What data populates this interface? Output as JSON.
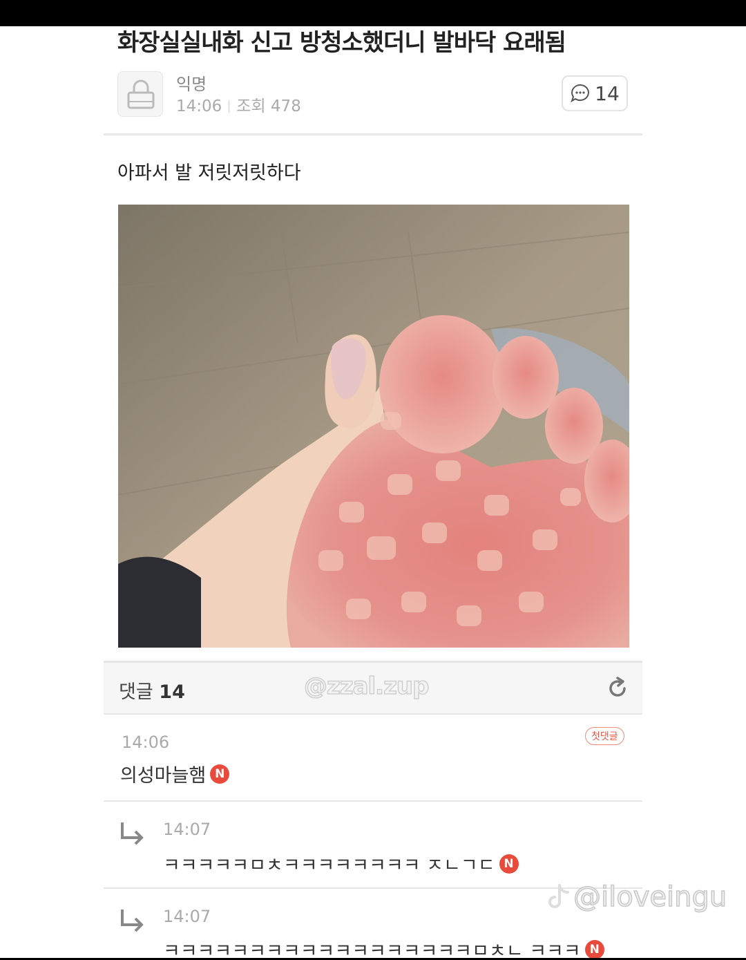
{
  "post": {
    "title": "화장실실내화 신고 방청소했더니 발바닥 요래됨",
    "author": "익명",
    "time": "14:06",
    "views_label": "조회 478",
    "comment_count": "14",
    "body": "아파서 발 저릿저릿하다"
  },
  "comments_header": {
    "label": "댓글",
    "count": "14",
    "watermark": "@zzal.zup"
  },
  "comments": [
    {
      "time": "14:06",
      "author": "의성마늘햄",
      "badge": "N",
      "first_label": "첫댓글"
    },
    {
      "time": "14:07",
      "text": "ㅋㅋㅋㅋㅋㅁㅊㅋㅋㅋㅋㅋㅋㅋㅋ ㅈㄴㄱㄷ",
      "badge": "N"
    },
    {
      "time": "14:07",
      "text": "ㅋㅋㅋㅋㅋㅋㅋㅋㅋㅋㅋㅋㅋㅋㅋㅋㅋㅋㅁㅊㄴ ㅋㅋㅋ",
      "badge": "N"
    }
  ],
  "overlay": {
    "tiktok_handle": "@iloveingu"
  },
  "icons": [
    "lock-icon",
    "speech-bubble-icon",
    "refresh-icon",
    "reply-arrow-icon",
    "tiktok-logo-icon"
  ],
  "colors": {
    "badge_red": "#e84a3b",
    "divider": "#e6e6e6",
    "muted_text": "#aaaaaa"
  }
}
